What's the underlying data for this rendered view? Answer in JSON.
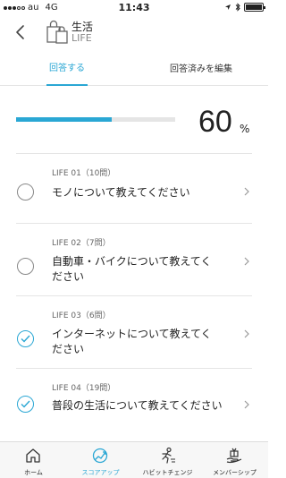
{
  "status_bar": {
    "carrier": "au",
    "network": "4G",
    "time": "11:43"
  },
  "header": {
    "title": "生活",
    "subtitle": "LIFE"
  },
  "tabs": {
    "answer": "回答する",
    "edit_answered": "回答済みを編集"
  },
  "progress": {
    "value": "60",
    "unit": "%",
    "fraction": 0.6
  },
  "questions": [
    {
      "meta": "LIFE 01（10問）",
      "title": "モノについて教えてください",
      "answered": false
    },
    {
      "meta": "LIFE 02（7問）",
      "title": "自動車・バイクについて教えてください",
      "answered": false
    },
    {
      "meta": "LIFE 03（6問）",
      "title": "インターネットについて教えてください",
      "answered": true
    },
    {
      "meta": "LIFE 04（19問）",
      "title": "普段の生活について教えてください",
      "answered": true
    }
  ],
  "bottom_nav": {
    "home": "ホーム",
    "score_up": "スコアアップ",
    "habit_change": "ハビットチェンジ",
    "membership": "メンバーシップ"
  },
  "colors": {
    "accent": "#2aa7d4"
  }
}
